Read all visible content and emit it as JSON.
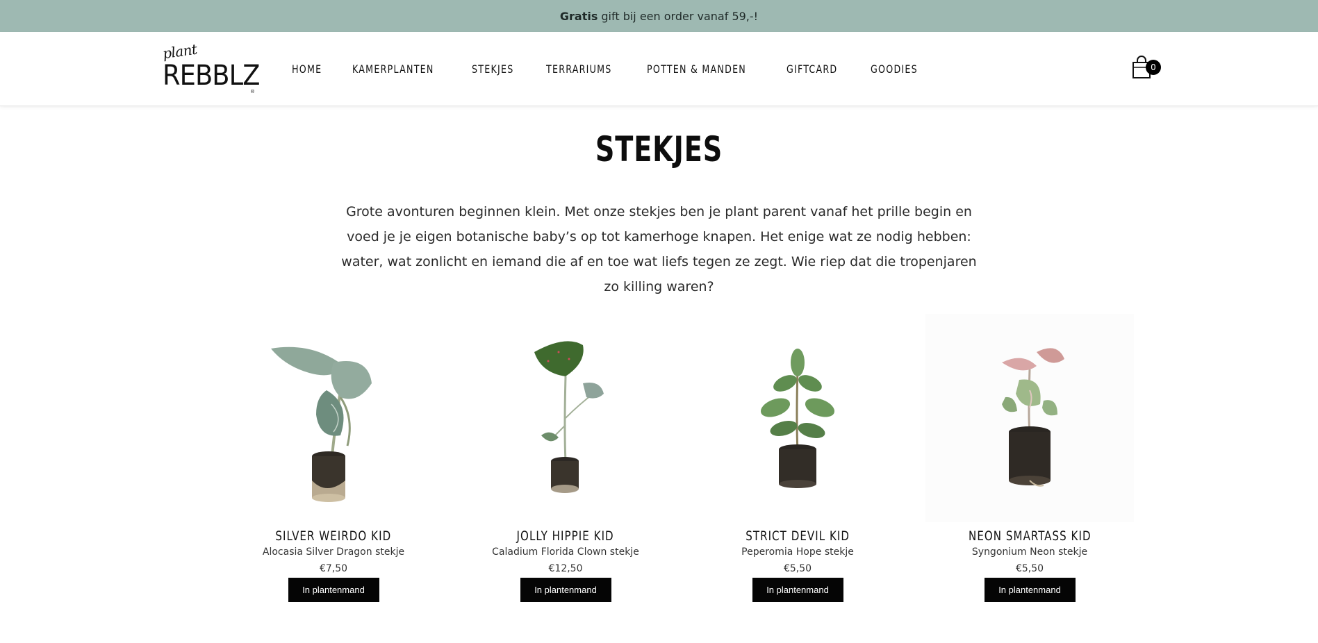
{
  "promo": {
    "bold": "Gratis",
    "text": "gift bij een order vanaf 59,-!"
  },
  "logo": {
    "small": "plant",
    "big": "REBBLZ",
    "reg": "®"
  },
  "nav": [
    "HOME",
    "KAMERPLANTEN",
    "STEKJES",
    "TERRARIUMS",
    "POTTEN & MANDEN",
    "GIFTCARD",
    "GOODIES"
  ],
  "cart": {
    "count": "0"
  },
  "page": {
    "title": "STEKJES",
    "intro": "Grote avonturen beginnen klein. Met onze stekjes ben je plant parent vanaf het prille begin en voed je je eigen botanische baby’s op tot kamerhoge knapen. Het enige wat ze nodig hebben: water, wat zonlicht en iemand die af en toe wat liefs tegen ze zegt. Wie riep dat die tropenjaren zo killing waren?"
  },
  "products": [
    {
      "name": "SILVER WEIRDO KID",
      "latin": "Alocasia Silver Dragon stekje",
      "price": "€7,50",
      "button": "In plantenmand"
    },
    {
      "name": "JOLLY HIPPIE KID",
      "latin": "Caladium Florida Clown stekje",
      "price": "€12,50",
      "button": "In plantenmand"
    },
    {
      "name": "STRICT DEVIL KID",
      "latin": "Peperomia Hope stekje",
      "price": "€5,50",
      "button": "In plantenmand"
    },
    {
      "name": "NEON SMARTASS KID",
      "latin": "Syngonium Neon stekje",
      "price": "€5,50",
      "button": "In plantenmand"
    }
  ],
  "colors": {
    "promo_bg": "#9eb9b2",
    "button_bg": "#050505",
    "text": "#111111"
  }
}
